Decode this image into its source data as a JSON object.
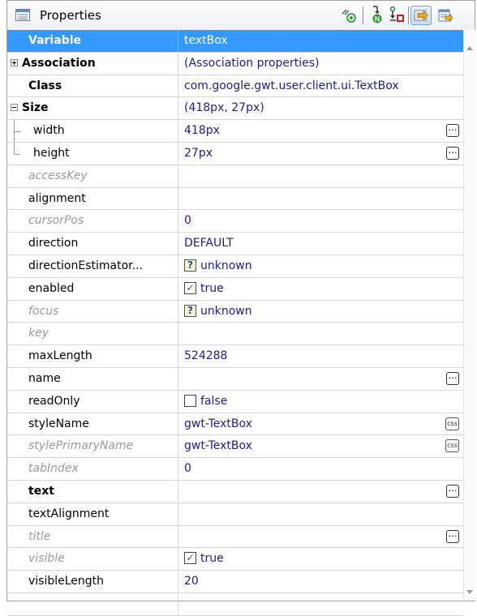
{
  "panel": {
    "title": "Properties",
    "toolbar_icons": [
      "show-events-icon",
      "goto-definition-icon",
      "variable-to-field-icon",
      "show-advanced-properties-icon",
      "defaults-icon"
    ]
  },
  "rows": [
    {
      "name": "Variable",
      "value": "textBox",
      "style": "bold",
      "selected": true
    },
    {
      "name": "Association",
      "value": "(Association properties)",
      "style": "bold",
      "expander": "plus"
    },
    {
      "name": "Class",
      "value": "com.google.gwt.user.client.ui.TextBox",
      "style": "bold"
    },
    {
      "name": "Size",
      "value": "(418px, 27px)",
      "style": "bold",
      "expander": "minus"
    },
    {
      "name": "width",
      "value": "418px",
      "style": "child",
      "button": "dots"
    },
    {
      "name": "height",
      "value": "27px",
      "style": "child",
      "button": "dots"
    },
    {
      "name": "accessKey",
      "value": "",
      "style": "gray"
    },
    {
      "name": "alignment",
      "value": "",
      "style": "normal"
    },
    {
      "name": "cursorPos",
      "value": "0",
      "style": "gray"
    },
    {
      "name": "direction",
      "value": "DEFAULT",
      "style": "normal"
    },
    {
      "name": "directionEstimator...",
      "value": "unknown",
      "style": "normal",
      "check": "?"
    },
    {
      "name": "enabled",
      "value": "true",
      "style": "normal",
      "check": "✓"
    },
    {
      "name": "focus",
      "value": "unknown",
      "style": "gray",
      "check": "?"
    },
    {
      "name": "key",
      "value": "",
      "style": "gray"
    },
    {
      "name": "maxLength",
      "value": "524288",
      "style": "normal"
    },
    {
      "name": "name",
      "value": "",
      "style": "normal",
      "button": "dots"
    },
    {
      "name": "readOnly",
      "value": "false",
      "style": "normal",
      "check": ""
    },
    {
      "name": "styleName",
      "value": "gwt-TextBox",
      "style": "normal",
      "button": "css"
    },
    {
      "name": "stylePrimaryName",
      "value": "gwt-TextBox",
      "style": "gray",
      "button": "css"
    },
    {
      "name": "tabIndex",
      "value": "0",
      "style": "gray"
    },
    {
      "name": "text",
      "value": "",
      "style": "bold",
      "button": "dots"
    },
    {
      "name": "textAlignment",
      "value": "",
      "style": "normal"
    },
    {
      "name": "title",
      "value": "",
      "style": "gray",
      "button": "dots"
    },
    {
      "name": "visible",
      "value": "true",
      "style": "gray",
      "check": "✓"
    },
    {
      "name": "visibleLength",
      "value": "20",
      "style": "normal"
    },
    {
      "name": "",
      "value": "",
      "style": "normal"
    }
  ],
  "colors": {
    "selection": "#3399ff",
    "value_text": "#1c1c8c",
    "gray_text": "#9a9a9a"
  },
  "labels": {
    "dots_button": "…",
    "css_button": "css"
  }
}
